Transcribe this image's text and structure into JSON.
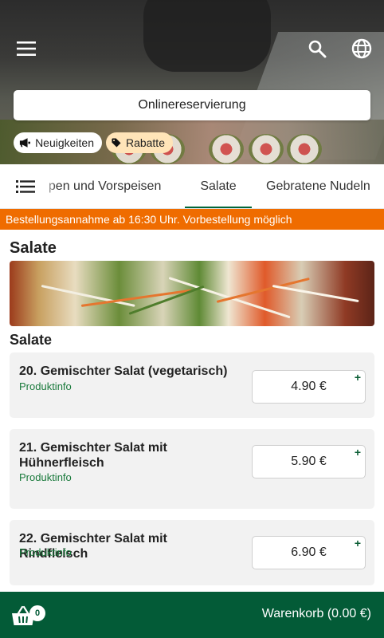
{
  "header": {
    "reservation_label": "Onlinereservierung",
    "chips": [
      {
        "label": "Neuigkeiten",
        "icon": "megaphone-icon"
      },
      {
        "label": "Rabatte",
        "icon": "tag-icon"
      }
    ]
  },
  "tabs": {
    "items": [
      {
        "label": "Suppen und Vorspeisen",
        "visible_text": "ppen und Vorspeisen",
        "active": false
      },
      {
        "label": "Salate",
        "active": true
      },
      {
        "label": "Gebratene Nudeln",
        "active": false
      }
    ]
  },
  "banner": {
    "text": "Bestellungsannahme ab 16:30 Uhr. Vorbestellung möglich"
  },
  "category": {
    "title": "Salate",
    "subtitle": "Salate"
  },
  "products": [
    {
      "name": "20. Gemischter Salat (vegetarisch)",
      "info": "Produktinfo",
      "price": "4.90 €",
      "add_symbol": "+"
    },
    {
      "name": "21. Gemischter Salat mit Hühnerfleisch",
      "info": "Produktinfo",
      "price": "5.90 €",
      "add_symbol": "+"
    },
    {
      "name": "22. Gemischter Salat mit Rindfleisch",
      "info": "Produktinfo",
      "price": "6.90 €",
      "add_symbol": "+"
    }
  ],
  "footer": {
    "cart_count": "0",
    "cart_label": "Warenkorb (0.00 €)"
  },
  "colors": {
    "primary_green": "#035b37",
    "banner_orange": "#ef6c00",
    "discount_chip": "#ffe4b8",
    "link_green": "#1a7a3c"
  }
}
